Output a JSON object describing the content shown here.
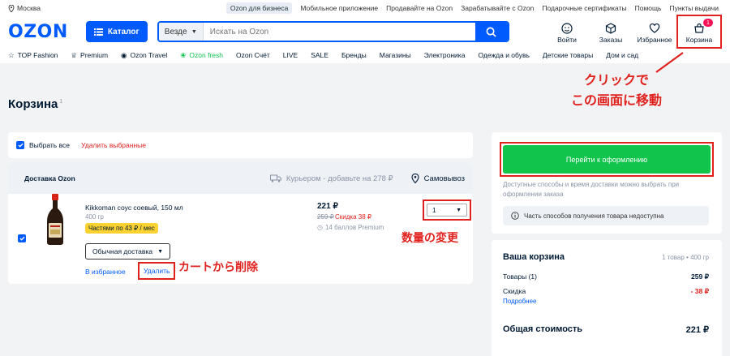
{
  "utility": {
    "location": "Москва",
    "links": [
      "Ozon для бизнеса",
      "Мобильное приложение",
      "Продавайте на Ozon",
      "Зарабатывайте с Ozon",
      "Подарочные сертификаты",
      "Помощь",
      "Пункты выдачи"
    ]
  },
  "header": {
    "logo": "OZON",
    "catalog_label": "Каталог",
    "search_scope": "Везде",
    "search_placeholder": "Искать на Ozon",
    "icons": [
      {
        "label": "Войти",
        "icon": "user-icon"
      },
      {
        "label": "Заказы",
        "icon": "box-icon"
      },
      {
        "label": "Избранное",
        "icon": "heart-icon"
      },
      {
        "label": "Корзина",
        "icon": "cart-icon",
        "badge": "1"
      }
    ]
  },
  "nav": [
    "TOP Fashion",
    "Premium",
    "Ozon Travel",
    "Ozon fresh",
    "Ozon Счёт",
    "LIVE",
    "SALE",
    "Бренды",
    "Магазины",
    "Электроника",
    "Одежда и обувь",
    "Детские товары",
    "Дом и сад"
  ],
  "page": {
    "title": "Корзина",
    "count": "1"
  },
  "select_bar": {
    "select_all": "Выбрать все",
    "delete_selected": "Удалить выбранные"
  },
  "delivery": {
    "title": "Доставка Ozon",
    "courier": "Курьером - добавьте на 278 ₽",
    "pickup": "Самовывоз"
  },
  "item": {
    "name": "Kikkoman соус соевый, 150 мл",
    "weight": "400 гр",
    "installment": "Частями по 43 ₽ / мес",
    "delivery_option": "Обычная доставка",
    "favorite": "В избранное",
    "remove": "Удалить",
    "price": "221 ₽",
    "old_price": "259 ₽",
    "discount": "Скидка 38 ₽",
    "points": "14 баллов Premium",
    "quantity": "1"
  },
  "annotations": {
    "cart_click_line1": "クリックで",
    "cart_click_line2": "この画面に移動",
    "quantity_change": "数量の変更",
    "remove_from_cart": "カートから削除"
  },
  "checkout": {
    "button": "Перейти к оформлению",
    "note": "Доступные способы и время доставки можно выбрать при оформлении заказа",
    "warning": "Часть способов получения товара недоступна"
  },
  "summary": {
    "title": "Ваша корзина",
    "meta": "1 товар • 400 гр",
    "goods_label": "Товары (1)",
    "goods_value": "259 ₽",
    "discount_label": "Скидка",
    "discount_value": "- 38 ₽",
    "more": "Подробнее",
    "total_label": "Общая стоимость",
    "total_value": "221 ₽"
  },
  "colors": {
    "brand": "#005bff",
    "accent_red": "#e0211d",
    "checkout_green": "#10c44c",
    "installment_yellow": "#fbd232"
  }
}
